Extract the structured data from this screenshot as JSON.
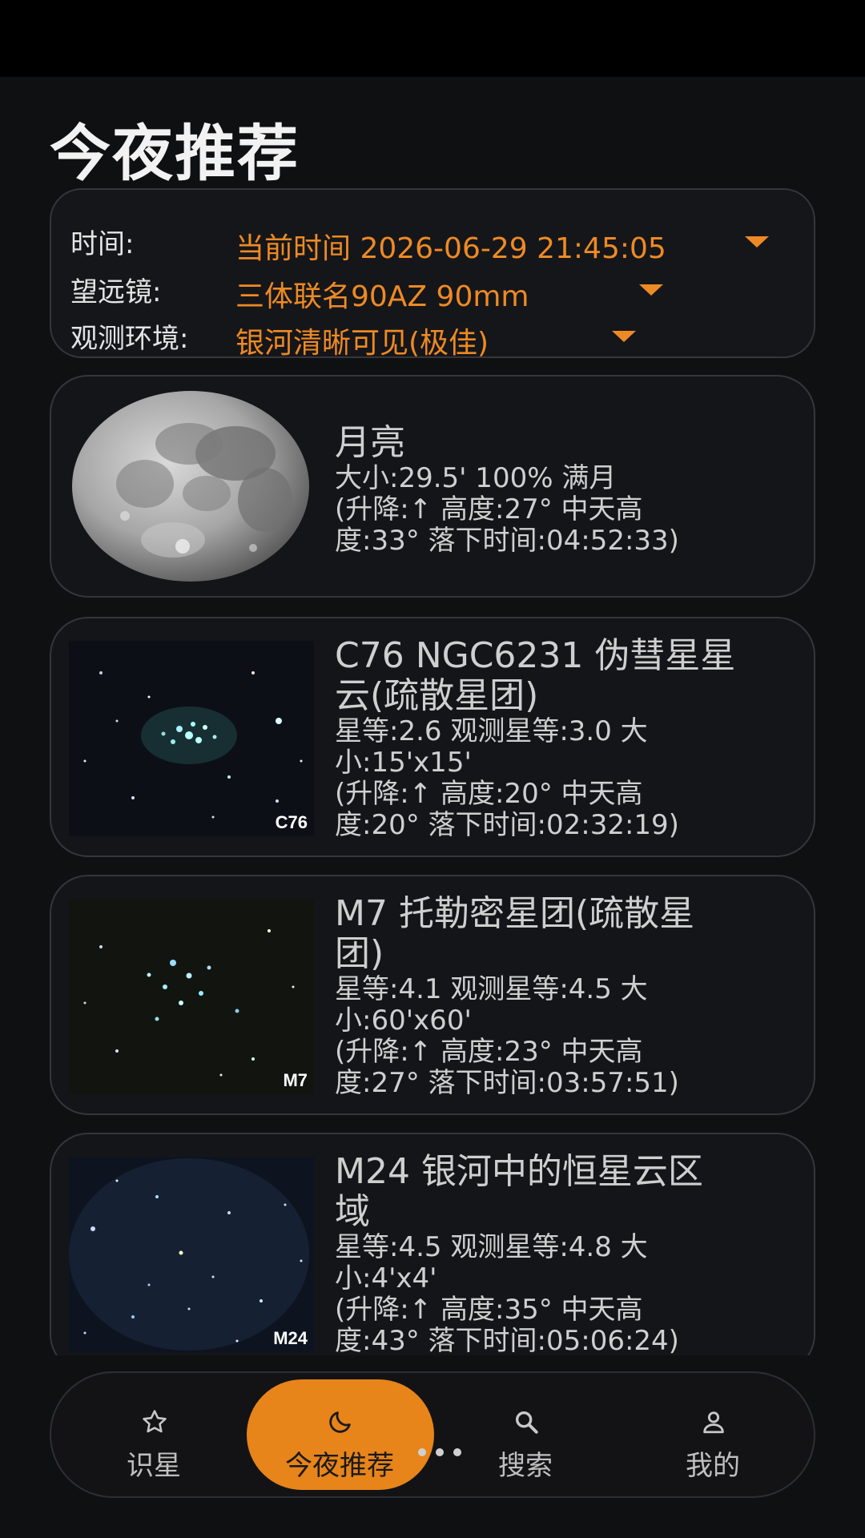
{
  "page": {
    "title": "今夜推荐"
  },
  "settings": {
    "time_label": "时间:",
    "time_value": "当前时间 2026-06-29 21:45:05",
    "telescope_label": "望远镜:",
    "telescope_value": "三体联名90AZ 90mm",
    "environment_label": "观测环境:",
    "environment_value": "银河清晰可见(极佳)",
    "accent_color": "#EE8A24"
  },
  "objects": [
    {
      "name": "月亮",
      "detail_lines": [
        "大小:29.5' 100% 满月",
        "(升降:↑ 高度:27° 中天高",
        "度:33° 落下时间:04:52:33)"
      ],
      "image": "moon-image"
    },
    {
      "name_lines": [
        "C76 NGC6231 伪彗星星",
        "云(疏散星团)"
      ],
      "detail_lines": [
        "星等:2.6 观测星等:3.0 大",
        "小:15'x15'",
        "(升降:↑ 高度:20° 中天高",
        "度:20° 落下时间:02:32:19)"
      ],
      "thumb_label": "C76"
    },
    {
      "name_lines": [
        "M7 托勒密星团(疏散星",
        "团)"
      ],
      "detail_lines": [
        "星等:4.1 观测星等:4.5 大",
        "小:60'x60'",
        "(升降:↑ 高度:23° 中天高",
        "度:27° 落下时间:03:57:51)"
      ],
      "thumb_label": "M7"
    },
    {
      "name_lines": [
        "M24 银河中的恒星云区",
        "域"
      ],
      "detail_lines": [
        "星等:4.5 观测星等:4.8 大",
        "小:4'x4'",
        "(升降:↑ 高度:35° 中天高",
        "度:43° 落下时间:05:06:24)"
      ],
      "thumb_label": "M24"
    }
  ],
  "nav": {
    "items": [
      {
        "label": "识星",
        "icon": "star-icon"
      },
      {
        "label": "今夜推荐",
        "icon": "moon-icon",
        "active": true
      },
      {
        "label": "搜索",
        "icon": "search-icon"
      },
      {
        "label": "我的",
        "icon": "person-icon"
      }
    ],
    "active_color": "#E7841A"
  }
}
